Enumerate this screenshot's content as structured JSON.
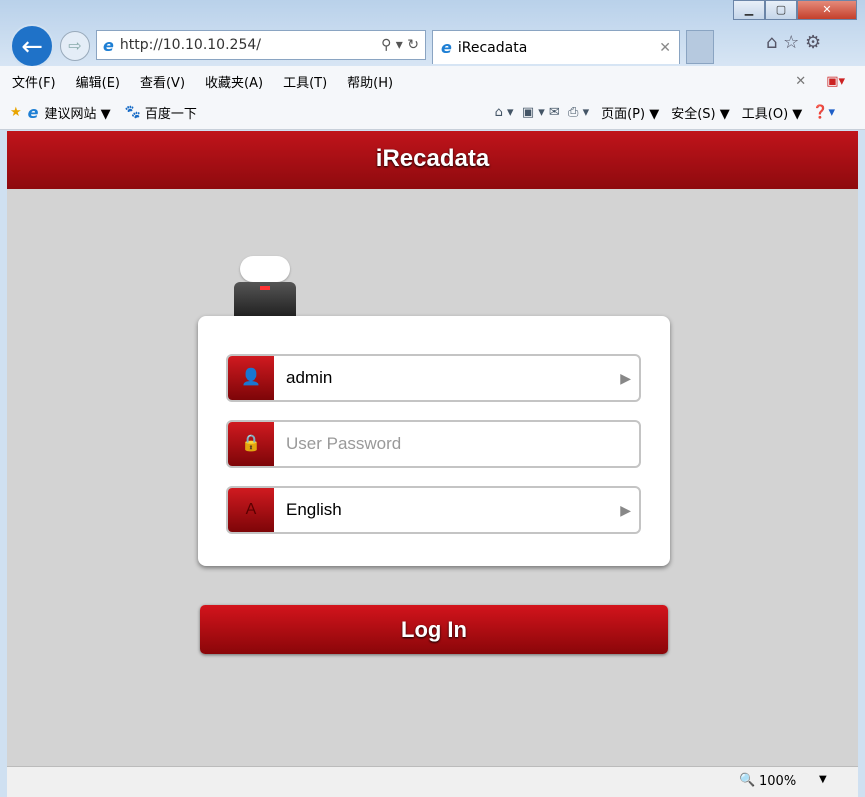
{
  "browser": {
    "url": "http://10.10.10.254/",
    "tab_title": "iRecadata",
    "menu": [
      "文件(F)",
      "编辑(E)",
      "查看(V)",
      "收藏夹(A)",
      "工具(T)",
      "帮助(H)"
    ],
    "favorites": {
      "suggested": "建议网站 ▼",
      "baidu": "百度一下"
    },
    "commands": [
      "页面(P) ▼",
      "安全(S) ▼",
      "工具(O) ▼"
    ],
    "zoom": "100%"
  },
  "page": {
    "title": "iRecadata",
    "username": "admin",
    "password_placeholder": "User Password",
    "language": "English",
    "login_label": "Log In"
  },
  "colors": {
    "accent": "#b01016",
    "background": "#d3d3d3"
  }
}
